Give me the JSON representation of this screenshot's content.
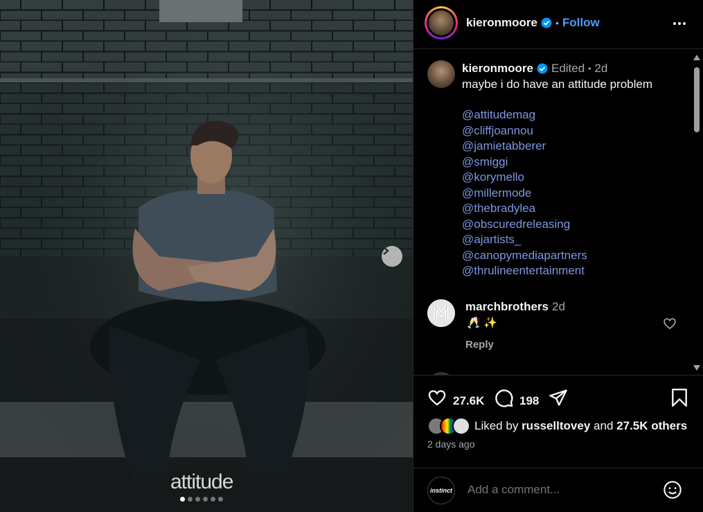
{
  "post": {
    "watermark": "attitude",
    "carousel_count": 6,
    "carousel_active": 1
  },
  "header": {
    "username": "kieronmoore",
    "separator": "•",
    "follow_label": "Follow"
  },
  "caption": {
    "username": "kieronmoore",
    "edited": "Edited",
    "dot": "•",
    "age": "2d",
    "text": "maybe i do have an attitude problem",
    "mentions": [
      "@attitudemag",
      "@cliffjoannou",
      "@jamietabberer",
      "@smiggi",
      "@korymello",
      "@millermode",
      "@thebradylea",
      "@obscuredreleasing",
      "@ajartists_",
      "@canopymediapartners",
      "@thrulineentertainment"
    ]
  },
  "comment": {
    "username": "marchbrothers",
    "age": "2d",
    "text": "🥂 ✨",
    "reply_label": "Reply"
  },
  "actions": {
    "likes": "27.6K",
    "comments": "198"
  },
  "liked_by": {
    "prefix": "Liked by",
    "user": "russelltovey",
    "and": "and",
    "others": "27.5K others"
  },
  "timestamp": "2 days ago",
  "add_comment": {
    "placeholder": "Add a comment...",
    "avatar_text": "instinct"
  },
  "colors": {
    "link": "#4f9cf9",
    "mention": "#7f96e0",
    "muted": "#a8a8a8",
    "verified": "#0095f6"
  }
}
